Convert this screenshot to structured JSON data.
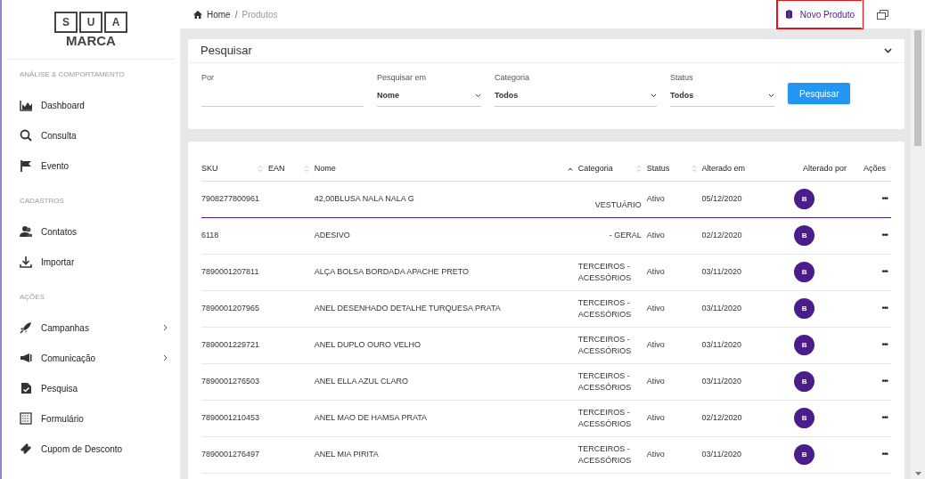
{
  "logo": {
    "letters": [
      "S",
      "U",
      "A"
    ],
    "word": "MARCA"
  },
  "sidebar": {
    "sections": [
      {
        "title": "ANÁLISE & COMPORTAMENTO",
        "items": [
          {
            "label": "Dashboard",
            "submenu": false
          },
          {
            "label": "Consulta",
            "submenu": false
          },
          {
            "label": "Evento",
            "submenu": false
          }
        ]
      },
      {
        "title": "CADASTROS",
        "items": [
          {
            "label": "Contatos",
            "submenu": false
          },
          {
            "label": "Importar",
            "submenu": false
          }
        ]
      },
      {
        "title": "AÇÕES",
        "items": [
          {
            "label": "Campanhas",
            "submenu": true
          },
          {
            "label": "Comunicação",
            "submenu": true
          },
          {
            "label": "Pesquisa",
            "submenu": false
          },
          {
            "label": "Formulário",
            "submenu": false
          },
          {
            "label": "Cupom de Desconto",
            "submenu": false
          }
        ]
      }
    ]
  },
  "breadcrumb": [
    "Home",
    "/",
    "Produtos"
  ],
  "new_button": {
    "label": "Novo Produto",
    "highlighted": true
  },
  "search": {
    "title": "Pesquisar",
    "fields": [
      {
        "kind": "text",
        "label": "Por"
      },
      {
        "kind": "select",
        "label": "Pesquisar em",
        "value": "Nome"
      },
      {
        "kind": "select",
        "label": "Categoria",
        "value": "Todos"
      },
      {
        "kind": "select",
        "label": "Status",
        "value": "Todos"
      }
    ],
    "button": "Pesquisar"
  },
  "table": {
    "columns": [
      {
        "label": "SKU",
        "sortable": true,
        "sorted": false
      },
      {
        "label": "EAN",
        "sortable": true,
        "sorted": false
      },
      {
        "label": "Nome",
        "sortable": true,
        "sorted": true
      },
      {
        "label": "Categoria",
        "sortable": true,
        "sorted": false
      },
      {
        "label": "Status",
        "sortable": true,
        "sorted": false
      },
      {
        "label": "Alterado em",
        "sortable": false
      },
      {
        "label": "Alterado por",
        "sortable": false
      },
      {
        "label": "Ações",
        "sortable": false
      }
    ],
    "rows": [
      {
        "sku": "7908277800961",
        "nome": "42,00BLUSA NALA NALA G",
        "categoria": "VESTUÁRIO",
        "status": "Ativo",
        "alterado_em": "05/12/2020",
        "avatar": "B",
        "actions": "•••",
        "selected": true
      },
      {
        "sku": "6118",
        "nome": "ADESIVO",
        "categoria": "- GERAL",
        "status": "Ativo",
        "alterado_em": "02/12/2020",
        "avatar": "B",
        "actions": "•••",
        "selected": false
      },
      {
        "sku": "7890001207811",
        "nome": "ALÇA BOLSA BORDADA APACHE PRETO",
        "categoria": "TERCEIROS - ACESSÓRIOS",
        "status": "Ativo",
        "alterado_em": "03/11/2020",
        "avatar": "B",
        "actions": "•••",
        "selected": false
      },
      {
        "sku": "7890001207965",
        "nome": "ANEL DESENHADO DETALHE TURQUESA PRATA",
        "categoria": "TERCEIROS - ACESSÓRIOS",
        "status": "Ativo",
        "alterado_em": "03/11/2020",
        "avatar": "B",
        "actions": "•••",
        "selected": false
      },
      {
        "sku": "7890001229721",
        "nome": "ANEL DUPLO OURO VELHO",
        "categoria": "TERCEIROS - ACESSÓRIOS",
        "status": "Ativo",
        "alterado_em": "03/11/2020",
        "avatar": "B",
        "actions": "•••",
        "selected": false
      },
      {
        "sku": "7890001276503",
        "nome": "ANEL ELLA AZUL CLARO",
        "categoria": "TERCEIROS - ACESSÓRIOS",
        "status": "Ativo",
        "alterado_em": "03/11/2020",
        "avatar": "B",
        "actions": "•••",
        "selected": false
      },
      {
        "sku": "7890001210453",
        "nome": "ANEL MAO DE HAMSA PRATA",
        "categoria": "TERCEIROS - ACESSÓRIOS",
        "status": "Ativo",
        "alterado_em": "02/12/2020",
        "avatar": "B",
        "actions": "•••",
        "selected": false
      },
      {
        "sku": "7890001276497",
        "nome": "ANEL MIA PIRITA",
        "categoria": "TERCEIROS - ACESSÓRIOS",
        "status": "Ativo",
        "alterado_em": "03/11/2020",
        "avatar": "B",
        "actions": "•••",
        "selected": false
      }
    ]
  }
}
